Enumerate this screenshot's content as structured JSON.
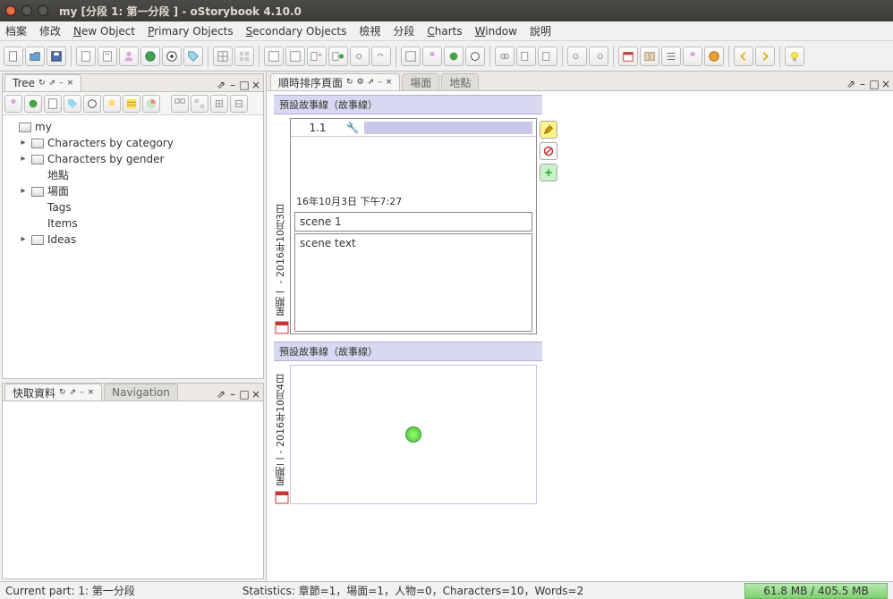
{
  "window": {
    "title": "my [分段 1: 第一分段 ] - oStorybook 4.10.0"
  },
  "menu": {
    "file": "档案",
    "edit": "修改",
    "newobj": "New Object",
    "primary": "Primary Objects",
    "secondary": "Secondary Objects",
    "view": "檢視",
    "parts": "分段",
    "charts": "Charts",
    "window": "Window",
    "help": "說明"
  },
  "panels": {
    "tree_title": "Tree",
    "quick_title": "快取資料",
    "nav_title": "Navigation",
    "chrono_title": "順時排序頁面",
    "scenes_tab": "場面",
    "locations_tab": "地點"
  },
  "tree": {
    "root": "my",
    "items": [
      "Characters by category",
      "Characters by gender",
      "地點",
      "場面",
      "Tags",
      "Items",
      "Ideas"
    ]
  },
  "storyline_header": "預設故事線（故事線）",
  "day1": {
    "label": "星期一 - 2016年10月3日"
  },
  "day2": {
    "label": "星期二 - 2016年10月4日"
  },
  "scene": {
    "number": "1.1",
    "datetime": "16年10月3日 下午7:27",
    "title": "scene 1",
    "text": "scene text"
  },
  "footer": {
    "part": "Current part: 1: 第一分段",
    "stats": "Statistics: 章節=1，場面=1，人物=0，Characters=10，Words=2",
    "memory": "61.8 MB / 405.5 MB"
  }
}
